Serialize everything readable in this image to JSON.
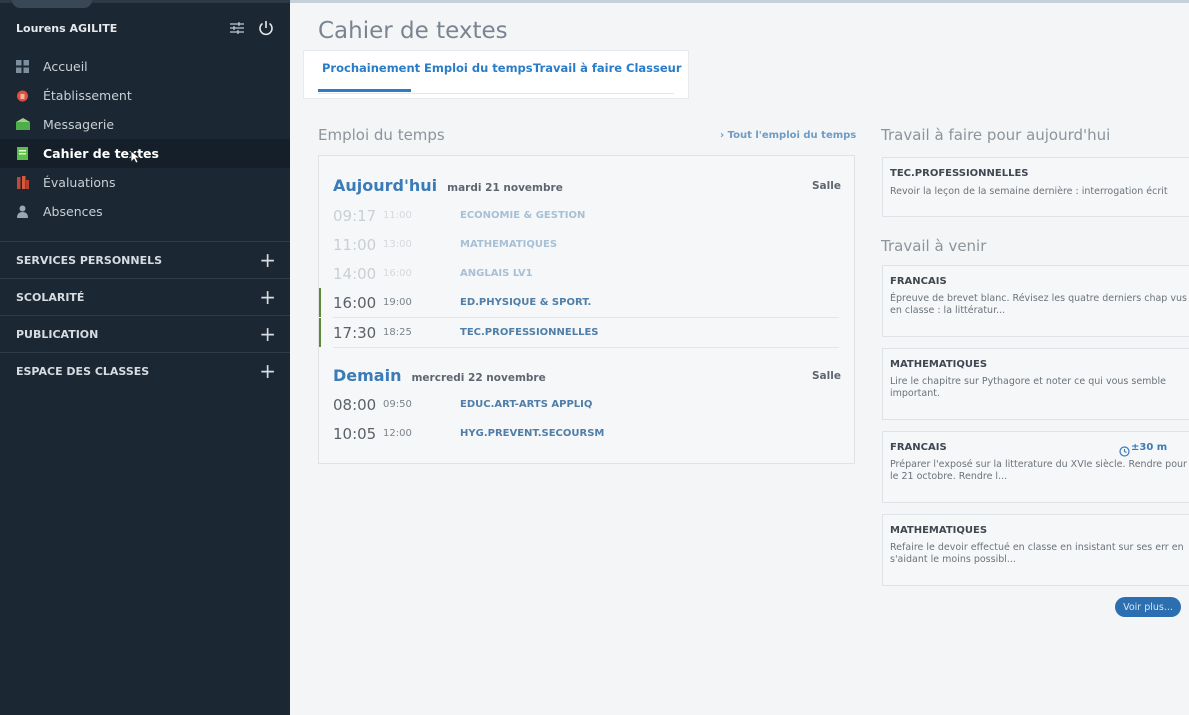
{
  "sidebar": {
    "user_name": "Lourens AGILITE",
    "items": [
      {
        "label": "Accueil",
        "icon": "grid-icon",
        "color": "#7d8f9c"
      },
      {
        "label": "Établissement",
        "icon": "building-icon",
        "color": "#e0503c"
      },
      {
        "label": "Messagerie",
        "icon": "mail-icon",
        "color": "#4fae4a"
      },
      {
        "label": "Cahier de textes",
        "icon": "book-icon",
        "color": "#5bbf4a",
        "active": true
      },
      {
        "label": "Évaluations",
        "icon": "evaluations-icon",
        "color": "#c04a34"
      },
      {
        "label": "Absences",
        "icon": "person-icon",
        "color": "#9aa6b0"
      }
    ],
    "sections": [
      "SERVICES PERSONNELS",
      "SCOLARITÉ",
      "PUBLICATION",
      "ESPACE DES CLASSES"
    ]
  },
  "main": {
    "title": "Cahier de textes",
    "tabs": [
      "Prochainement",
      "Emploi du temps",
      "Travail à faire",
      "Classeur"
    ],
    "schedule": {
      "title": "Emploi du temps",
      "link": "› Tout l'emploi du temps",
      "room_header": "Salle",
      "days": [
        {
          "name": "Aujourd'hui",
          "date": "mardi 21 novembre",
          "rows": [
            {
              "start": "09:17",
              "end": "11:00",
              "subject": "ECONOMIE & GESTION",
              "state": "past"
            },
            {
              "start": "11:00",
              "end": "13:00",
              "subject": "MATHEMATIQUES",
              "state": "past"
            },
            {
              "start": "14:00",
              "end": "16:00",
              "subject": "ANGLAIS LV1",
              "state": "past"
            },
            {
              "start": "16:00",
              "end": "19:00",
              "subject": "ED.PHYSIQUE & SPORT.",
              "state": "current"
            },
            {
              "start": "17:30",
              "end": "18:25",
              "subject": "TEC.PROFESSIONNELLES",
              "state": "current"
            }
          ]
        },
        {
          "name": "Demain",
          "date": "mercredi 22 novembre",
          "rows": [
            {
              "start": "08:00",
              "end": "09:50",
              "subject": "EDUC.ART-ARTS APPLIQ",
              "state": "future"
            },
            {
              "start": "10:05",
              "end": "12:00",
              "subject": "HYG.PREVENT.SECOURSM",
              "state": "future"
            }
          ]
        }
      ]
    },
    "today_work": {
      "title": "Travail à faire pour aujourd'hui",
      "items": [
        {
          "subject": "TEC.PROFESSIONNELLES",
          "desc": "Revoir la leçon de la semaine dernière : interrogation écrit"
        }
      ]
    },
    "upcoming_work": {
      "title": "Travail à venir",
      "items": [
        {
          "subject": "FRANCAIS",
          "desc": "Épreuve de brevet blanc.  Révisez les quatre derniers chap vus en classe :  la littératur..."
        },
        {
          "subject": "MATHEMATIQUES",
          "desc": "Lire le chapitre sur Pythagore et noter ce qui vous semble important."
        },
        {
          "subject": "FRANCAIS",
          "duration": "±30 m",
          "desc": "Préparer l'exposé sur la litterature du XVIe siècle.  Rendre pour le 21 octobre. Rendre l..."
        },
        {
          "subject": "MATHEMATIQUES",
          "desc": "Refaire le devoir effectué en classe en insistant sur ses err en s'aidant le moins possibl..."
        }
      ],
      "more_button": "Voir plus..."
    }
  }
}
